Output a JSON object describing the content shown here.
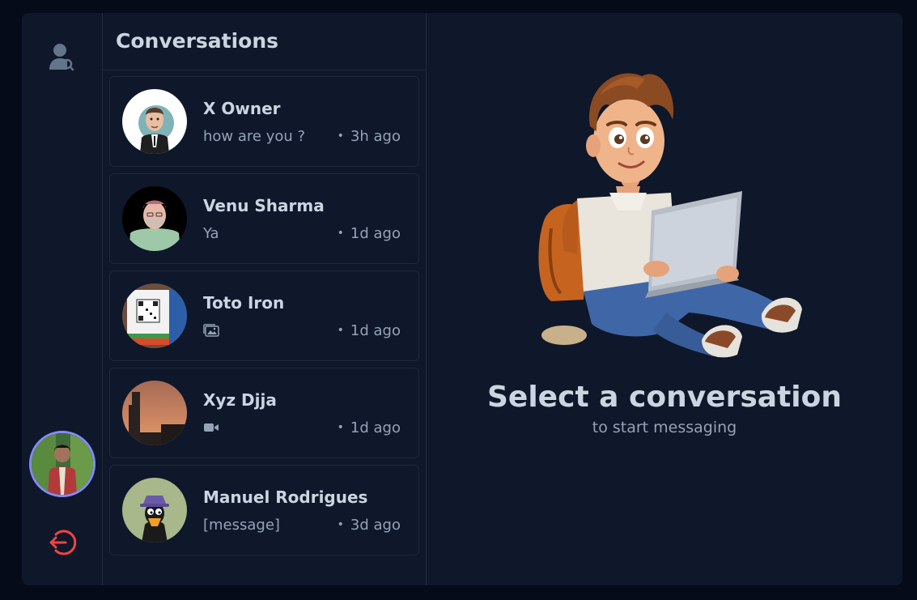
{
  "sidebar": {
    "search_icon": "user-search-icon",
    "logout_icon": "logout-icon",
    "logout_color": "#ef4444",
    "avatar_ring_color": "#818cf8"
  },
  "conversations": {
    "title": "Conversations",
    "items": [
      {
        "name": "X Owner",
        "preview": "how are you ?",
        "time": "3h ago"
      },
      {
        "name": "Venu Sharma",
        "preview": "Ya",
        "time": "1d ago"
      },
      {
        "name": "Toto Iron",
        "preview_icon": "image-icon",
        "time": "1d ago"
      },
      {
        "name": "Xyz Djja",
        "preview_icon": "video-icon",
        "time": "1d ago"
      },
      {
        "name": "Manuel Rodrigues",
        "preview": "[message]",
        "time": "3d ago"
      }
    ]
  },
  "empty_state": {
    "title": "Select a conversation",
    "subtitle": "to start messaging"
  }
}
